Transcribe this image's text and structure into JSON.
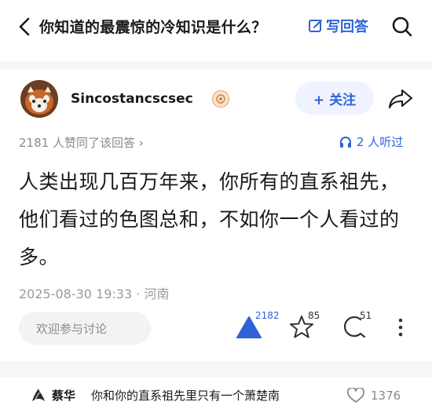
{
  "header": {
    "title": "你知道的最震惊的冷知识是什么？",
    "write_answer_label": "写回答"
  },
  "author": {
    "name": "Sincostancscsec",
    "follow_label": "+ 关注"
  },
  "stats": {
    "likes_note": "2181 人赞同了该回答 ›",
    "listeners": "2 人听过"
  },
  "answer": {
    "content": "人类出现几百万年来，你所有的直系祖先，他们看过的色图总和，不如你一个人看过的多。",
    "meta": "2025-08-30 19:33 · 河南"
  },
  "actions": {
    "comment_placeholder": "欢迎参与讨论",
    "upvote_count": "2182",
    "star_count": "85",
    "comment_count": "51"
  },
  "hot_comment": {
    "name": "蔡华",
    "text": "你和你的直系祖先里只有一个萧楚南",
    "likes": "1376"
  },
  "colors": {
    "accent": "#2f62d8",
    "muted": "#8a8a8a",
    "text": "#1a1a1a"
  },
  "icons": [
    "back-icon",
    "edit-icon",
    "search-icon",
    "avatar",
    "badge-icon",
    "share-icon",
    "headphones-icon",
    "upvote-icon",
    "star-icon",
    "comment-icon",
    "more-icon",
    "heart-icon"
  ]
}
